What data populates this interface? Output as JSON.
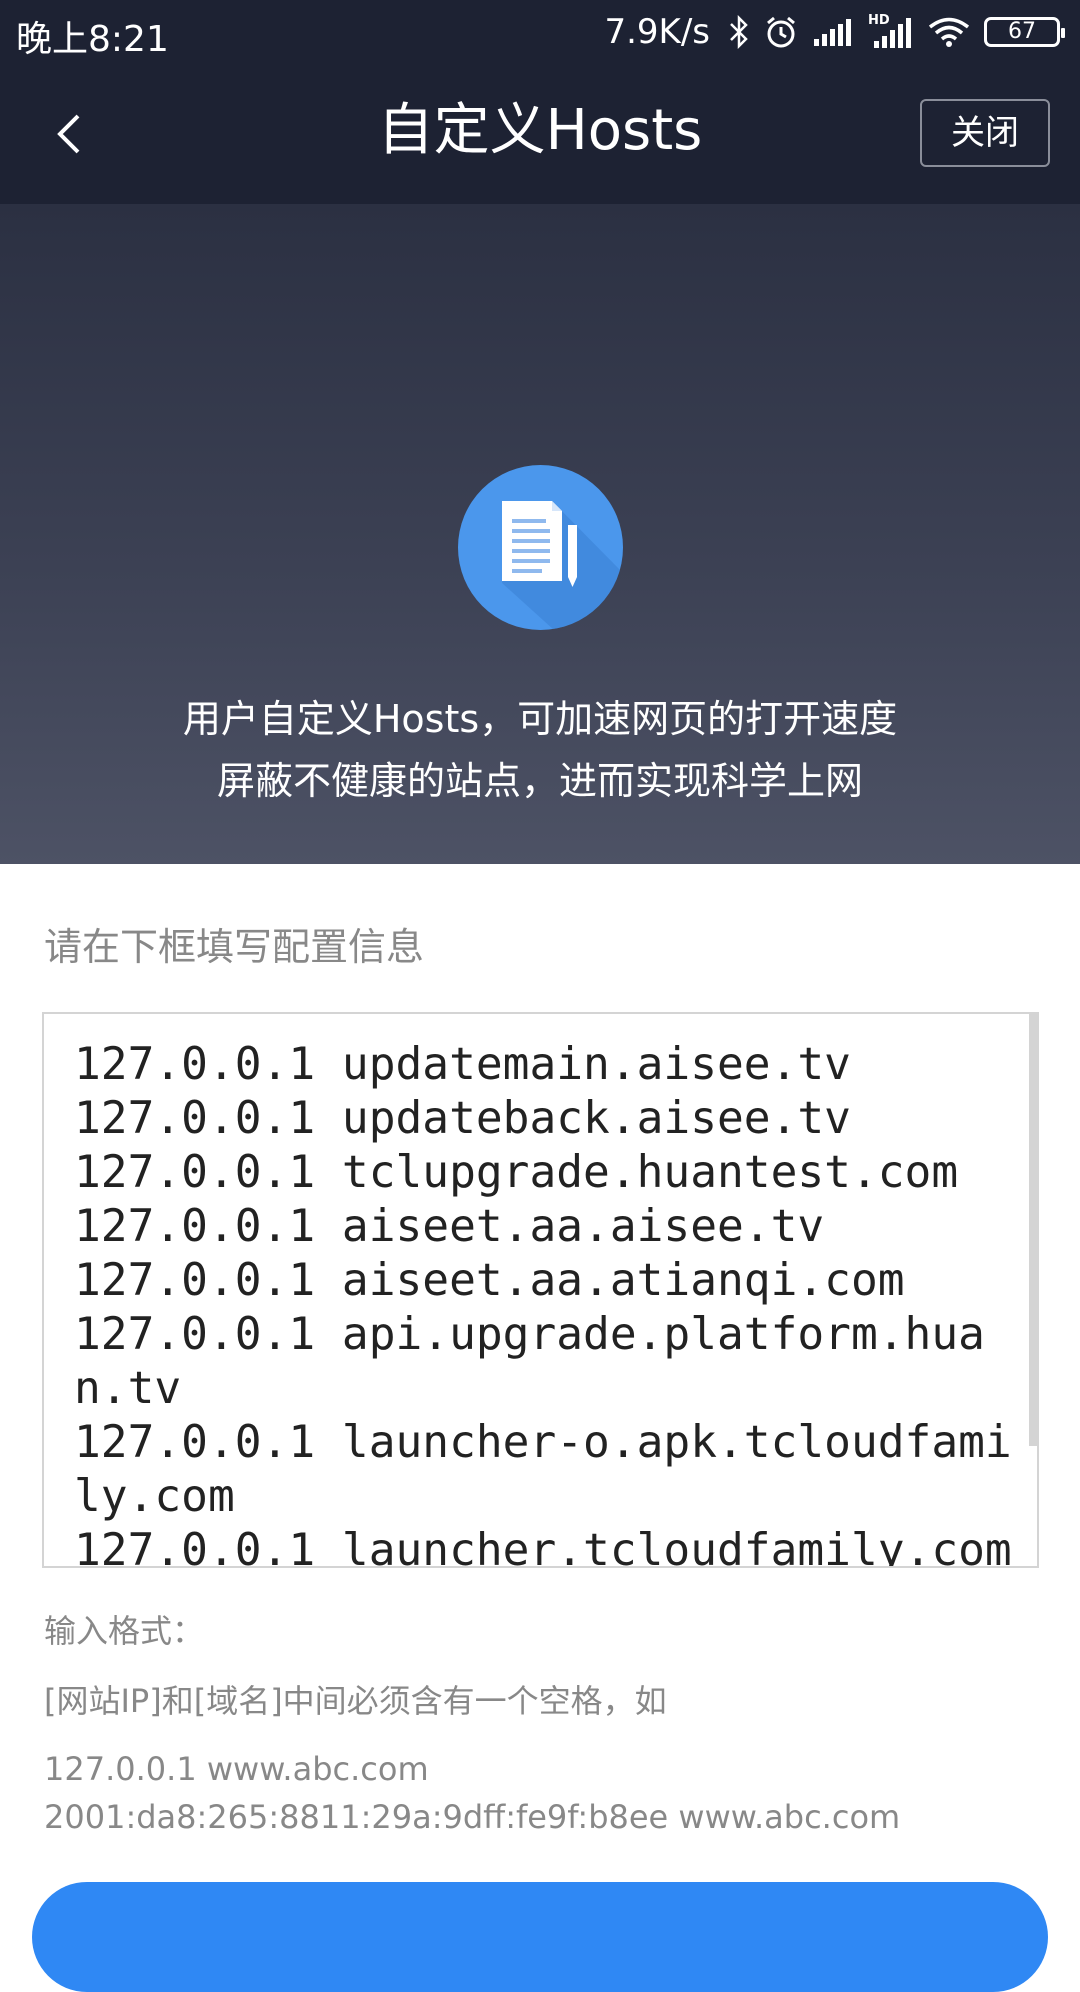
{
  "status_bar": {
    "time": "晚上8:21",
    "net_speed": "7.9K/s",
    "signal_label": "HD",
    "battery": "67"
  },
  "nav": {
    "title": "自定义Hosts",
    "close_label": "关闭"
  },
  "hero": {
    "line1": "用户自定义Hosts，可加速网页的打开速度",
    "line2": "屏蔽不健康的站点，进而实现科学上网"
  },
  "form": {
    "config_label": "请在下框填写配置信息",
    "hosts_lines": [
      "127.0.0.1 updatemain.aisee.tv",
      "127.0.0.1 updateback.aisee.tv",
      "127.0.0.1 tclupgrade.huantest.com",
      "127.0.0.1 aiseet.aa.aisee.tv",
      "127.0.0.1 aiseet.aa.atianqi.com",
      "127.0.0.1 api.upgrade.platform.huan.tv",
      "127.0.0.1 launcher-o.apk.tcloudfamily.com",
      "127.0.0.1 launcher.tcloudfamily.com"
    ],
    "format_title": "输入格式：",
    "format_desc": "[网站IP]和[域名]中间必须含有一个空格，如",
    "format_example_1": "127.0.0.1 www.abc.com",
    "format_example_2": "2001:da8:265:8811:29a:9dff:fe9f:b8ee www.abc.com"
  },
  "colors": {
    "header_bg": "#1d2233",
    "accent": "#2f88f4",
    "icon_circle": "#4b97ec"
  }
}
